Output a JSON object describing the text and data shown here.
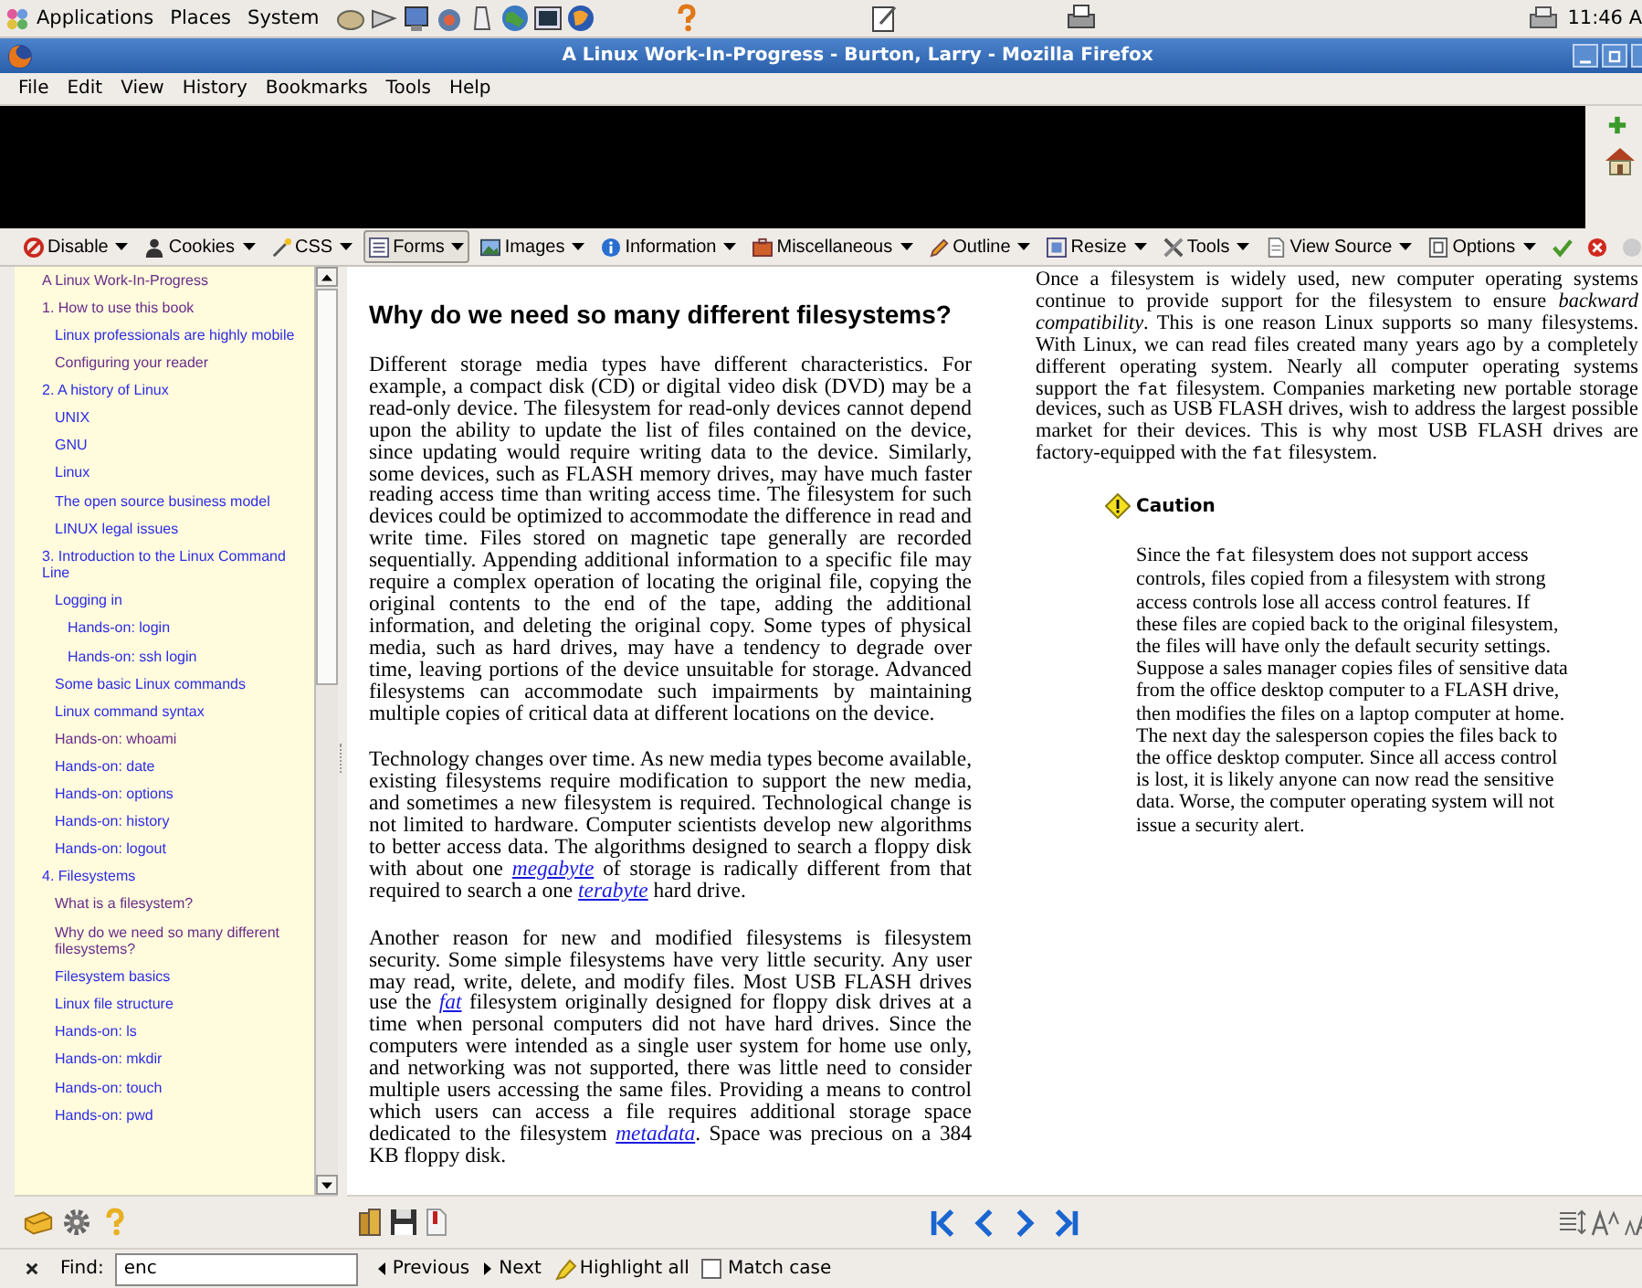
{
  "top_panel": {
    "menus": [
      "Applications",
      "Places",
      "System"
    ],
    "clock": "11:46 A"
  },
  "window": {
    "title": "A Linux Work-In-Progress - Burton, Larry - Mozilla Firefox"
  },
  "menu_bar": [
    "File",
    "Edit",
    "View",
    "History",
    "Bookmarks",
    "Tools",
    "Help"
  ],
  "dev_toolbar": [
    {
      "label": "Disable",
      "selected": false
    },
    {
      "label": "Cookies",
      "selected": false
    },
    {
      "label": "CSS",
      "selected": false
    },
    {
      "label": "Forms",
      "selected": true
    },
    {
      "label": "Images",
      "selected": false
    },
    {
      "label": "Information",
      "selected": false
    },
    {
      "label": "Miscellaneous",
      "selected": false
    },
    {
      "label": "Outline",
      "selected": false
    },
    {
      "label": "Resize",
      "selected": false
    },
    {
      "label": "Tools",
      "selected": false
    },
    {
      "label": "View Source",
      "selected": false
    },
    {
      "label": "Options",
      "selected": false
    }
  ],
  "sidebar": {
    "items": [
      {
        "label": "A Linux Work-In-Progress",
        "visited": true
      },
      {
        "label": "1. How to use this book",
        "visited": true,
        "children": [
          {
            "label": "Linux professionals are highly mobile",
            "visited": false
          },
          {
            "label": "Configuring your reader",
            "visited": true
          }
        ]
      },
      {
        "label": "2. A history of Linux",
        "visited": false,
        "children": [
          {
            "label": "UNIX",
            "visited": false
          },
          {
            "label": "GNU",
            "visited": false
          },
          {
            "label": "Linux",
            "visited": false
          },
          {
            "label": "The open source business model",
            "visited": false
          },
          {
            "label": "LINUX legal issues",
            "visited": false
          }
        ]
      },
      {
        "label": "3. Introduction to the Linux Command Line",
        "visited": false,
        "children": [
          {
            "label": "Logging in",
            "visited": false,
            "children": [
              {
                "label": "Hands-on: login",
                "visited": false
              },
              {
                "label": "Hands-on: ssh login",
                "visited": false
              }
            ]
          },
          {
            "label": "Some basic Linux commands",
            "visited": false
          },
          {
            "label": "Linux command syntax",
            "visited": false
          },
          {
            "label": "Hands-on: whoami",
            "visited": true
          },
          {
            "label": "Hands-on: date",
            "visited": false
          },
          {
            "label": "Hands-on: options",
            "visited": false
          },
          {
            "label": "Hands-on: history",
            "visited": false
          },
          {
            "label": "Hands-on: logout",
            "visited": false
          }
        ]
      },
      {
        "label": "4. Filesystems",
        "visited": false,
        "children": [
          {
            "label": "What is a filesystem?",
            "visited": true
          },
          {
            "label": "Why do we need so many different filesystems?",
            "visited": true
          },
          {
            "label": "Filesystem basics",
            "visited": false
          },
          {
            "label": "Linux file structure",
            "visited": false
          },
          {
            "label": "Hands-on: ls",
            "visited": false
          },
          {
            "label": "Hands-on: mkdir",
            "visited": false
          },
          {
            "label": "Hands-on: touch",
            "visited": false
          },
          {
            "label": "Hands-on: pwd",
            "visited": false
          }
        ]
      }
    ]
  },
  "page": {
    "heading": "Why do we need so many different filesystems?",
    "column_1": [
      {
        "segments": [
          {
            "kind": "text",
            "text": "Different storage media types have different characteristics. For example, a compact disk (CD) or digital video disk (DVD) may be a read-only device. The filesystem for read-only devices cannot depend upon the ability to update the list of files contained on the device, since updating would require writing data to the device. Similarly, some devices, such as FLASH memory drives, may have much faster reading access time than writing access time. The filesystem for such devices could be optimized to accommodate the difference in read and write time. Files stored on magnetic tape generally are recorded sequentially. Appending additional information to a specific file may require a complex operation of locating the original file, copying the original contents to the end of the tape, adding the additional information, and deleting the original copy. Some types of physical media, such as hard drives, may have a tendency to degrade over time, leaving portions of the device unsuitable for storage. Advanced filesystems can accommodate such impairments by maintaining multiple copies of critical data at different locations on the device."
          }
        ]
      },
      {
        "segments": [
          {
            "kind": "text",
            "text": "Technology changes over time. As new media types become available, existing filesystems require modification to support the new media, and sometimes a new filesystem is required. Technological change is not limited to hardware. Computer scientists develop new algorithms to better access data. The algorithms designed to search a floppy disk with about one "
          },
          {
            "kind": "link",
            "text": "megabyte"
          },
          {
            "kind": "text",
            "text": " of storage is radically different from that required to search a one "
          },
          {
            "kind": "link",
            "text": "terabyte"
          },
          {
            "kind": "text",
            "text": " hard drive."
          }
        ]
      },
      {
        "segments": [
          {
            "kind": "text",
            "text": "Another reason for new and modified filesystems is filesystem security. Some simple filesystems have very little security. Any user may read, write, delete, and modify files. Most USB FLASH drives use the "
          },
          {
            "kind": "link",
            "text": "fat"
          },
          {
            "kind": "text",
            "text": " filesystem originally designed for floppy disk drives at a time when personal computers did not have hard drives. Since the computers were intended as a single user system for home use only, and networking was not supported, there was little need to consider multiple users accessing the same files. Providing a means to control which users can access a file requires additional storage space dedicated to the filesystem "
          },
          {
            "kind": "link",
            "text": "metadata"
          },
          {
            "kind": "text",
            "text": ". Space was precious on a 384 KB floppy disk."
          }
        ]
      }
    ],
    "column_2": {
      "paragraphs": [
        {
          "segments": [
            {
              "kind": "text",
              "text": "Once a filesystem is widely used, new computer operating systems continue to provide support for the filesystem to ensure *backward compatibility*. This is one reason Linux supports so many filesystems. With Linux, we can read files created many years ago by a completely different operating system. Nearly all computer operating systems support the "
            },
            {
              "kind": "code",
              "text": "fat"
            },
            {
              "kind": "text",
              "text": " filesystem. Companies marketing new portable storage devices, such as USB FLASH drives, wish to address the largest possible market for their devices. This is why most USB FLASH drives are factory-equipped with the "
            },
            {
              "kind": "code",
              "text": "fat"
            },
            {
              "kind": "text",
              "text": " filesystem."
            }
          ]
        }
      ],
      "caution": {
        "title": "Caution",
        "paragraph": {
          "segments": [
            {
              "kind": "text",
              "text": "Since the "
            },
            {
              "kind": "code",
              "text": "fat"
            },
            {
              "kind": "text",
              "text": " filesystem does not support access controls, files copied from a filesystem with strong access controls lose all access control features. If these files are copied back to the original filesystem, the files will have only the default security settings. Suppose a sales manager copies files of sensitive data from the office desktop computer to a FLASH drive, then modifies the files on a laptop computer at home. The next day the salesperson copies the files back to the office desktop computer. Since all access control is lost, it is likely anyone can now read the sensitive data. Worse, the computer operating system will not issue a security alert."
            }
          ]
        }
      }
    }
  },
  "find_bar": {
    "label": "Find:",
    "value": "enc",
    "buttons": [
      "Previous",
      "Next",
      "Highlight all"
    ],
    "match_case": {
      "label": "Match case",
      "checked": false
    }
  }
}
